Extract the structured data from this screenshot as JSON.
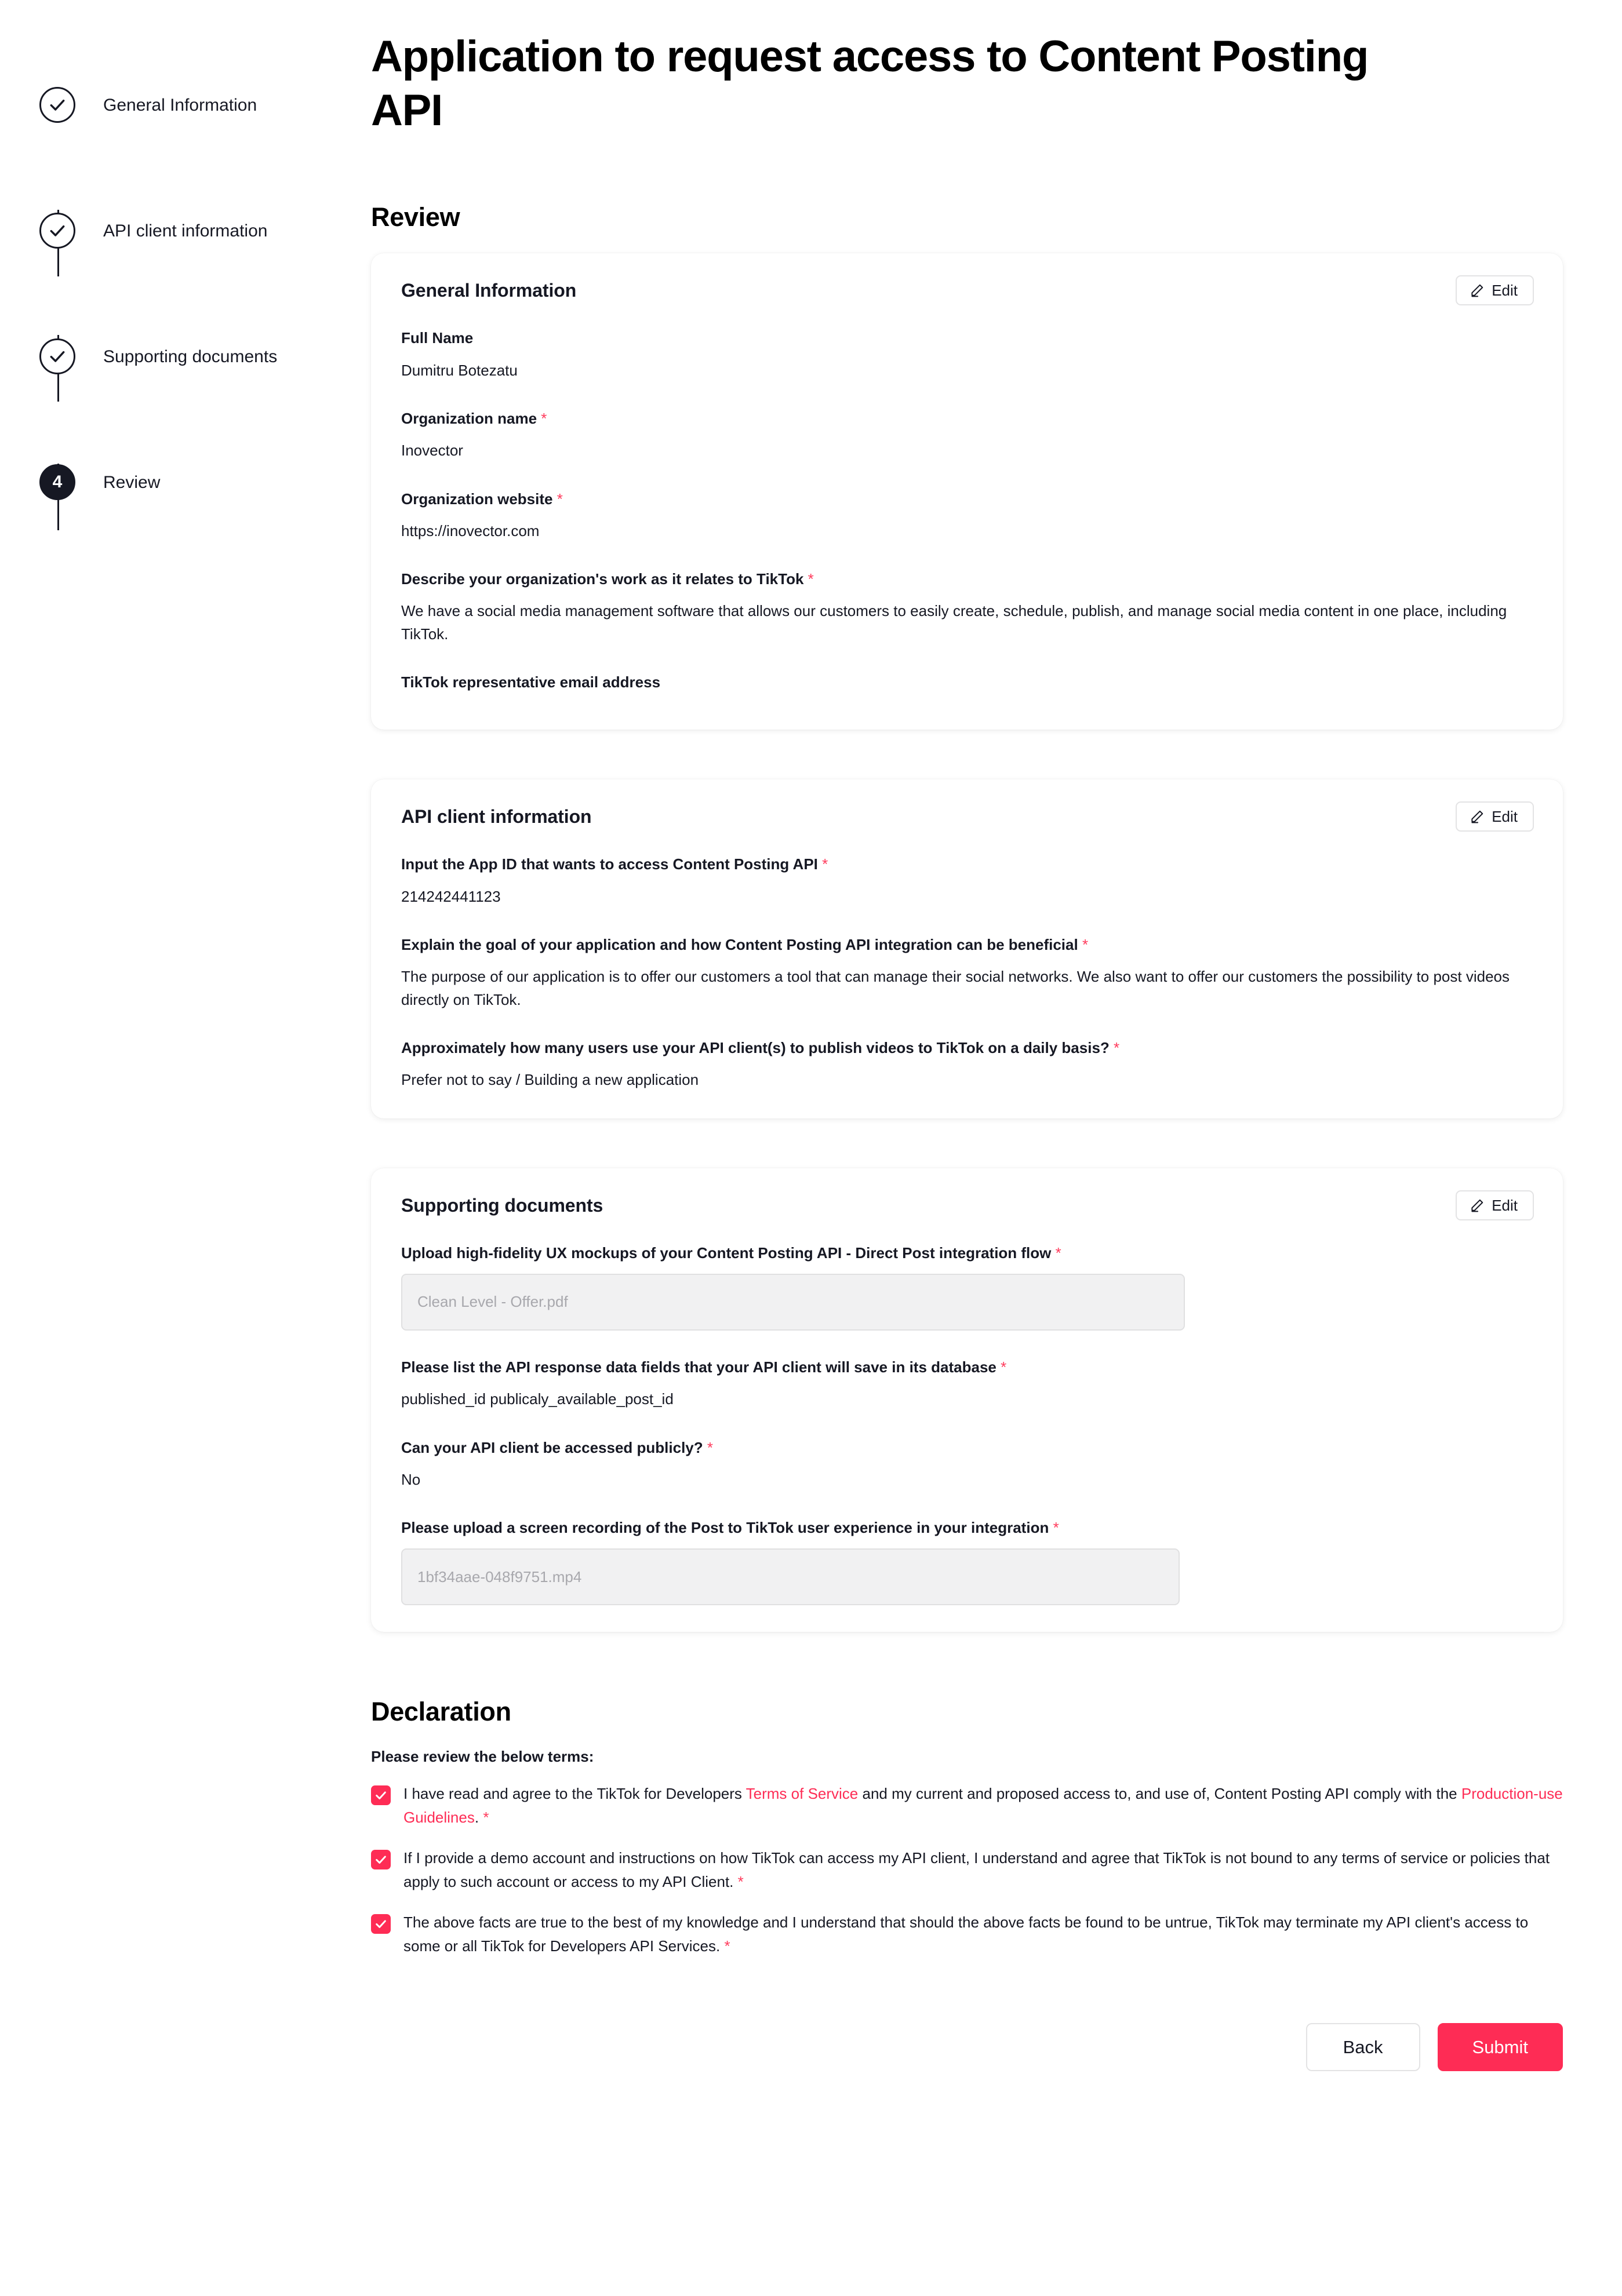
{
  "stepper": {
    "steps": [
      {
        "label": "General Information",
        "state": "complete",
        "icon": "check-icon"
      },
      {
        "label": "API client information",
        "state": "complete",
        "icon": "check-icon"
      },
      {
        "label": "Supporting documents",
        "state": "complete",
        "icon": "check-icon"
      },
      {
        "label": "Review",
        "state": "active",
        "number": "4"
      }
    ]
  },
  "header": {
    "title": "Application to request access to Content Posting API",
    "section_title": "Review"
  },
  "cards": {
    "general": {
      "title": "General Information",
      "edit_label": "Edit",
      "fields": {
        "full_name_label": "Full Name",
        "full_name_value": "Dumitru Botezatu",
        "org_name_label": "Organization name",
        "org_name_value": "Inovector",
        "org_website_label": "Organization website",
        "org_website_value": "https://inovector.com",
        "describe_label": "Describe your organization's work as it relates to TikTok",
        "describe_value": "We have a social media management software that allows our customers to easily create, schedule, publish, and manage social media content in one place, including TikTok.",
        "rep_email_label": "TikTok representative email address",
        "rep_email_value": ""
      }
    },
    "api_client": {
      "title": "API client information",
      "edit_label": "Edit",
      "fields": {
        "app_id_label": "Input the App ID that wants to access Content Posting API",
        "app_id_value": "214242441123",
        "goal_label": "Explain the goal of your application and how Content Posting API integration can be beneficial",
        "goal_value": "The purpose of our application is to offer our customers a tool that can manage their social networks. We also want to offer our customers the possibility to post videos directly on TikTok.",
        "users_label": "Approximately how many users use your API client(s) to publish videos to TikTok on a daily basis?",
        "users_value": "Prefer not to say / Building a new application"
      }
    },
    "supporting": {
      "title": "Supporting documents",
      "edit_label": "Edit",
      "fields": {
        "mockups_label": "Upload high-fidelity UX mockups of your Content Posting API - Direct Post integration flow",
        "mockups_file": "Clean Level - Offer.pdf",
        "data_fields_label": "Please list the API response data fields that your API client will save in its database",
        "data_fields_value": "published_id publicaly_available_post_id",
        "public_label": "Can your API client be accessed publicly?",
        "public_value": "No",
        "recording_label": "Please upload a screen recording of the Post to TikTok user experience in your integration",
        "recording_file": "1bf34aae-048f9751.mp4"
      }
    }
  },
  "declaration": {
    "title": "Declaration",
    "intro": "Please review the below terms:",
    "terms": [
      {
        "checked": true,
        "part1": "I have read and agree to the TikTok for Developers ",
        "link1": "Terms of Service",
        "part2": " and my current and proposed access to, and use of, Content Posting API comply with the ",
        "link2": "Production-use Guidelines",
        "part3": ".",
        "required": "*"
      },
      {
        "checked": true,
        "part1": "If I provide a demo account and instructions on how TikTok can access my API client, I understand and agree that TikTok is not bound to any terms of service or policies that apply to such account or access to my API Client.",
        "required": "*"
      },
      {
        "checked": true,
        "part1": "The above facts are true to the best of my knowledge and I understand that should the above facts be found to be untrue, TikTok may terminate my API client's access to some or all TikTok for Developers API Services.",
        "required": "*"
      }
    ]
  },
  "footer": {
    "back_label": "Back",
    "submit_label": "Submit"
  },
  "colors": {
    "brand_red": "#fe2c55",
    "required_asterisk": "#ff3b5c",
    "text": "#161823",
    "muted": "#a8a8ad"
  }
}
